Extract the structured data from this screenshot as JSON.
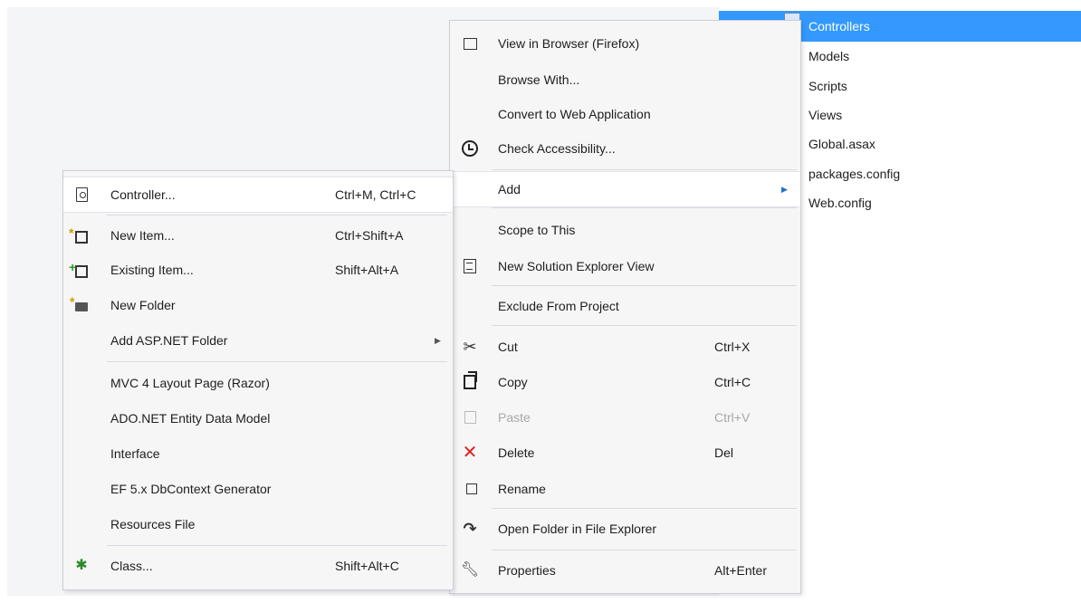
{
  "solution_tree": {
    "items": [
      "Controllers",
      "Models",
      "Scripts",
      "Views",
      "Global.asax",
      "packages.config",
      "Web.config"
    ],
    "selected_index": 0
  },
  "context_menu": {
    "view_in_browser": "View in Browser (Firefox)",
    "browse_with": "Browse With...",
    "convert": "Convert to Web Application",
    "check_accessibility": "Check Accessibility...",
    "add": "Add",
    "scope_to_this": "Scope to This",
    "new_solution_view": "New Solution Explorer View",
    "exclude": "Exclude From Project",
    "cut": {
      "label": "Cut",
      "shortcut": "Ctrl+X"
    },
    "copy": {
      "label": "Copy",
      "shortcut": "Ctrl+C"
    },
    "paste": {
      "label": "Paste",
      "shortcut": "Ctrl+V"
    },
    "delete": {
      "label": "Delete",
      "shortcut": "Del"
    },
    "rename": "Rename",
    "open_folder": "Open Folder in File Explorer",
    "properties": {
      "label": "Properties",
      "shortcut": "Alt+Enter"
    }
  },
  "add_submenu": {
    "controller": {
      "label": "Controller...",
      "shortcut": "Ctrl+M, Ctrl+C"
    },
    "new_item": {
      "label": "New Item...",
      "shortcut": "Ctrl+Shift+A"
    },
    "existing_item": {
      "label": "Existing Item...",
      "shortcut": "Shift+Alt+A"
    },
    "new_folder": "New Folder",
    "asp_folder": "Add ASP.NET Folder",
    "mvc_layout": "MVC 4 Layout Page (Razor)",
    "ado_entity": "ADO.NET Entity Data Model",
    "interface": "Interface",
    "ef_generator": "EF 5.x DbContext Generator",
    "resources": "Resources File",
    "class": {
      "label": "Class...",
      "shortcut": "Shift+Alt+C"
    }
  },
  "colors": {
    "selection": "#3399ff",
    "menu_bg": "#f6f6f6",
    "delete_icon": "#e02020",
    "submenu_arrow": "#1e72c8"
  }
}
